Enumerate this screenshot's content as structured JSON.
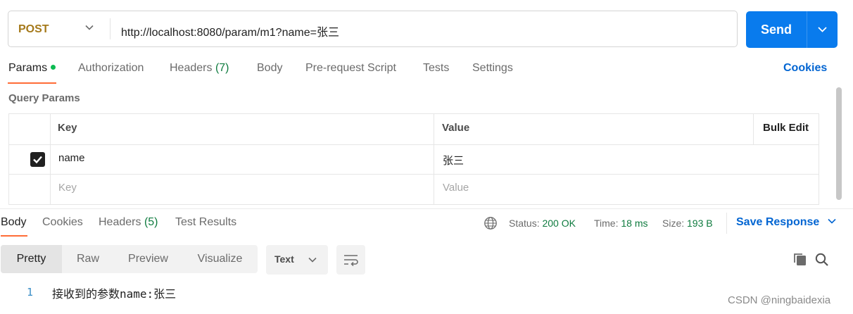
{
  "request": {
    "method": "POST",
    "url": "http://localhost:8080/param/m1?name=张三",
    "send_label": "Send"
  },
  "request_tabs": {
    "params": "Params",
    "authorization": "Authorization",
    "headers": "Headers",
    "headers_count": "(7)",
    "body": "Body",
    "pre_request": "Pre-request Script",
    "tests": "Tests",
    "settings": "Settings",
    "cookies": "Cookies"
  },
  "query_params": {
    "title": "Query Params",
    "headers": {
      "key": "Key",
      "value": "Value",
      "bulk_edit": "Bulk Edit"
    },
    "rows": [
      {
        "checked": true,
        "key": "name",
        "value": "张三"
      }
    ],
    "placeholder": {
      "key": "Key",
      "value": "Value"
    }
  },
  "response_tabs": {
    "body": "Body",
    "cookies": "Cookies",
    "headers": "Headers",
    "headers_count": "(5)",
    "test_results": "Test Results"
  },
  "response_status": {
    "status_label": "Status:",
    "status_value": "200 OK",
    "time_label": "Time:",
    "time_value": "18 ms",
    "size_label": "Size:",
    "size_value": "193 B",
    "save_response": "Save Response"
  },
  "view_modes": {
    "pretty": "Pretty",
    "raw": "Raw",
    "preview": "Preview",
    "visualize": "Visualize",
    "format": "Text"
  },
  "response_body": {
    "line_number": "1",
    "content": "接收到的参数name:张三"
  },
  "watermark": "CSDN @ningbaidexia",
  "colors": {
    "send": "#097bed",
    "accent_underline": "#ff6c37",
    "link": "#0265d2",
    "success": "#0f7b3f",
    "method_post": "#a5791a"
  }
}
